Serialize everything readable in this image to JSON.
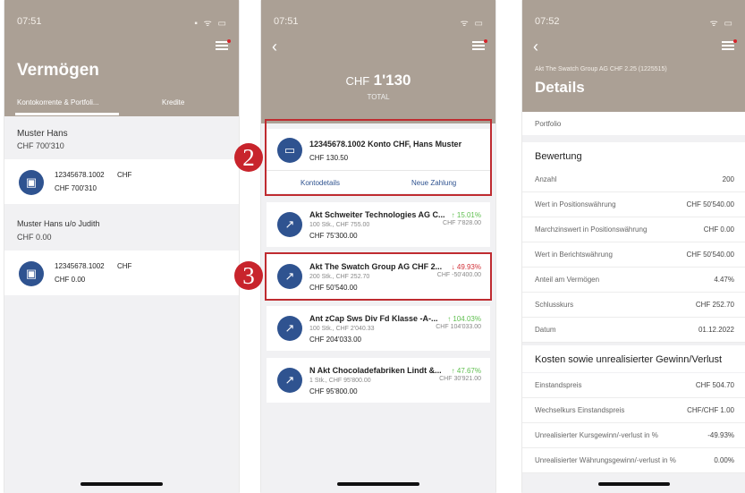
{
  "colors": {
    "header": "#aba095",
    "accent": "#2f5390",
    "marker": "#c8242c",
    "gain": "#5fbf4f",
    "loss": "#d2333a"
  },
  "screen1": {
    "time": "07:51",
    "title": "Vermögen",
    "tabs": [
      "Kontokorrente & Portfoli...",
      "Kredite"
    ],
    "groups": [
      {
        "name": "Muster Hans",
        "total": "CHF 700'310",
        "item": {
          "account": "12345678.1002",
          "currency": "CHF",
          "amount": "CHF 700'310"
        }
      },
      {
        "name": "Muster Hans u/o Judith",
        "total": "CHF 0.00",
        "item": {
          "account": "12345678.1002",
          "currency": "CHF",
          "amount": "CHF 0.00"
        }
      }
    ]
  },
  "screen2": {
    "time": "07:51",
    "currency": "CHF",
    "total": "1'130",
    "total_label": "TOTAL",
    "account": {
      "title": "12345678.1002 Konto CHF, Hans Muster",
      "amount": "CHF 130.50",
      "actions": [
        "Kontodetails",
        "Neue Zahlung"
      ]
    },
    "markers": [
      "2",
      "3"
    ],
    "positions": [
      {
        "name": "Akt Schweiter Technologies AG C...",
        "sub": "100 Stk., CHF 755.00",
        "value": "CHF 75'300.00",
        "change": "↑ 15.01%",
        "change_sub": "CHF 7'828.00",
        "dir": "up"
      },
      {
        "name": "Akt The Swatch Group AG CHF 2...",
        "sub": "200 Stk., CHF 252.70",
        "value": "CHF 50'540.00",
        "change": "↓ 49.93%",
        "change_sub": "CHF -50'400.00",
        "dir": "down"
      },
      {
        "name": "Ant zCap Sws Div Fd Klasse -A-...",
        "sub": "100 Stk., CHF 2'040.33",
        "value": "CHF 204'033.00",
        "change": "↑ 104.03%",
        "change_sub": "CHF 104'033.00",
        "dir": "up"
      },
      {
        "name": "N Akt Chocoladefabriken Lindt &...",
        "sub": "1 Stk., CHF 95'800.00",
        "value": "CHF 95'800.00",
        "change": "↑ 47.67%",
        "change_sub": "CHF 30'921.00",
        "dir": "up"
      }
    ]
  },
  "screen3": {
    "time": "07:52",
    "subtitle": "Akt The Swatch Group AG CHF 2.25 (1225515)",
    "title": "Details",
    "portfolio_label": "Portfolio",
    "section1": "Bewertung",
    "rows1": [
      {
        "k": "Anzahl",
        "v": "200"
      },
      {
        "k": "Wert in Positionswährung",
        "v": "CHF 50'540.00"
      },
      {
        "k": "Marchzinswert in Positionswährung",
        "v": "CHF 0.00"
      },
      {
        "k": "Wert in Berichtswährung",
        "v": "CHF 50'540.00"
      },
      {
        "k": "Anteil am Vermögen",
        "v": "4.47%"
      },
      {
        "k": "Schlusskurs",
        "v": "CHF 252.70"
      },
      {
        "k": "Datum",
        "v": "01.12.2022"
      }
    ],
    "section2": "Kosten sowie unrealisierter Gewinn/Verlust",
    "rows2": [
      {
        "k": "Einstandspreis",
        "v": "CHF 504.70"
      },
      {
        "k": "Wechselkurs Einstandspreis",
        "v": "CHF/CHF 1.00"
      },
      {
        "k": "Unrealisierter Kursgewinn/-verlust in %",
        "v": "-49.93%"
      },
      {
        "k": "Unrealisierter Währungsgewinn/-verlust in %",
        "v": "0.00%"
      }
    ]
  }
}
